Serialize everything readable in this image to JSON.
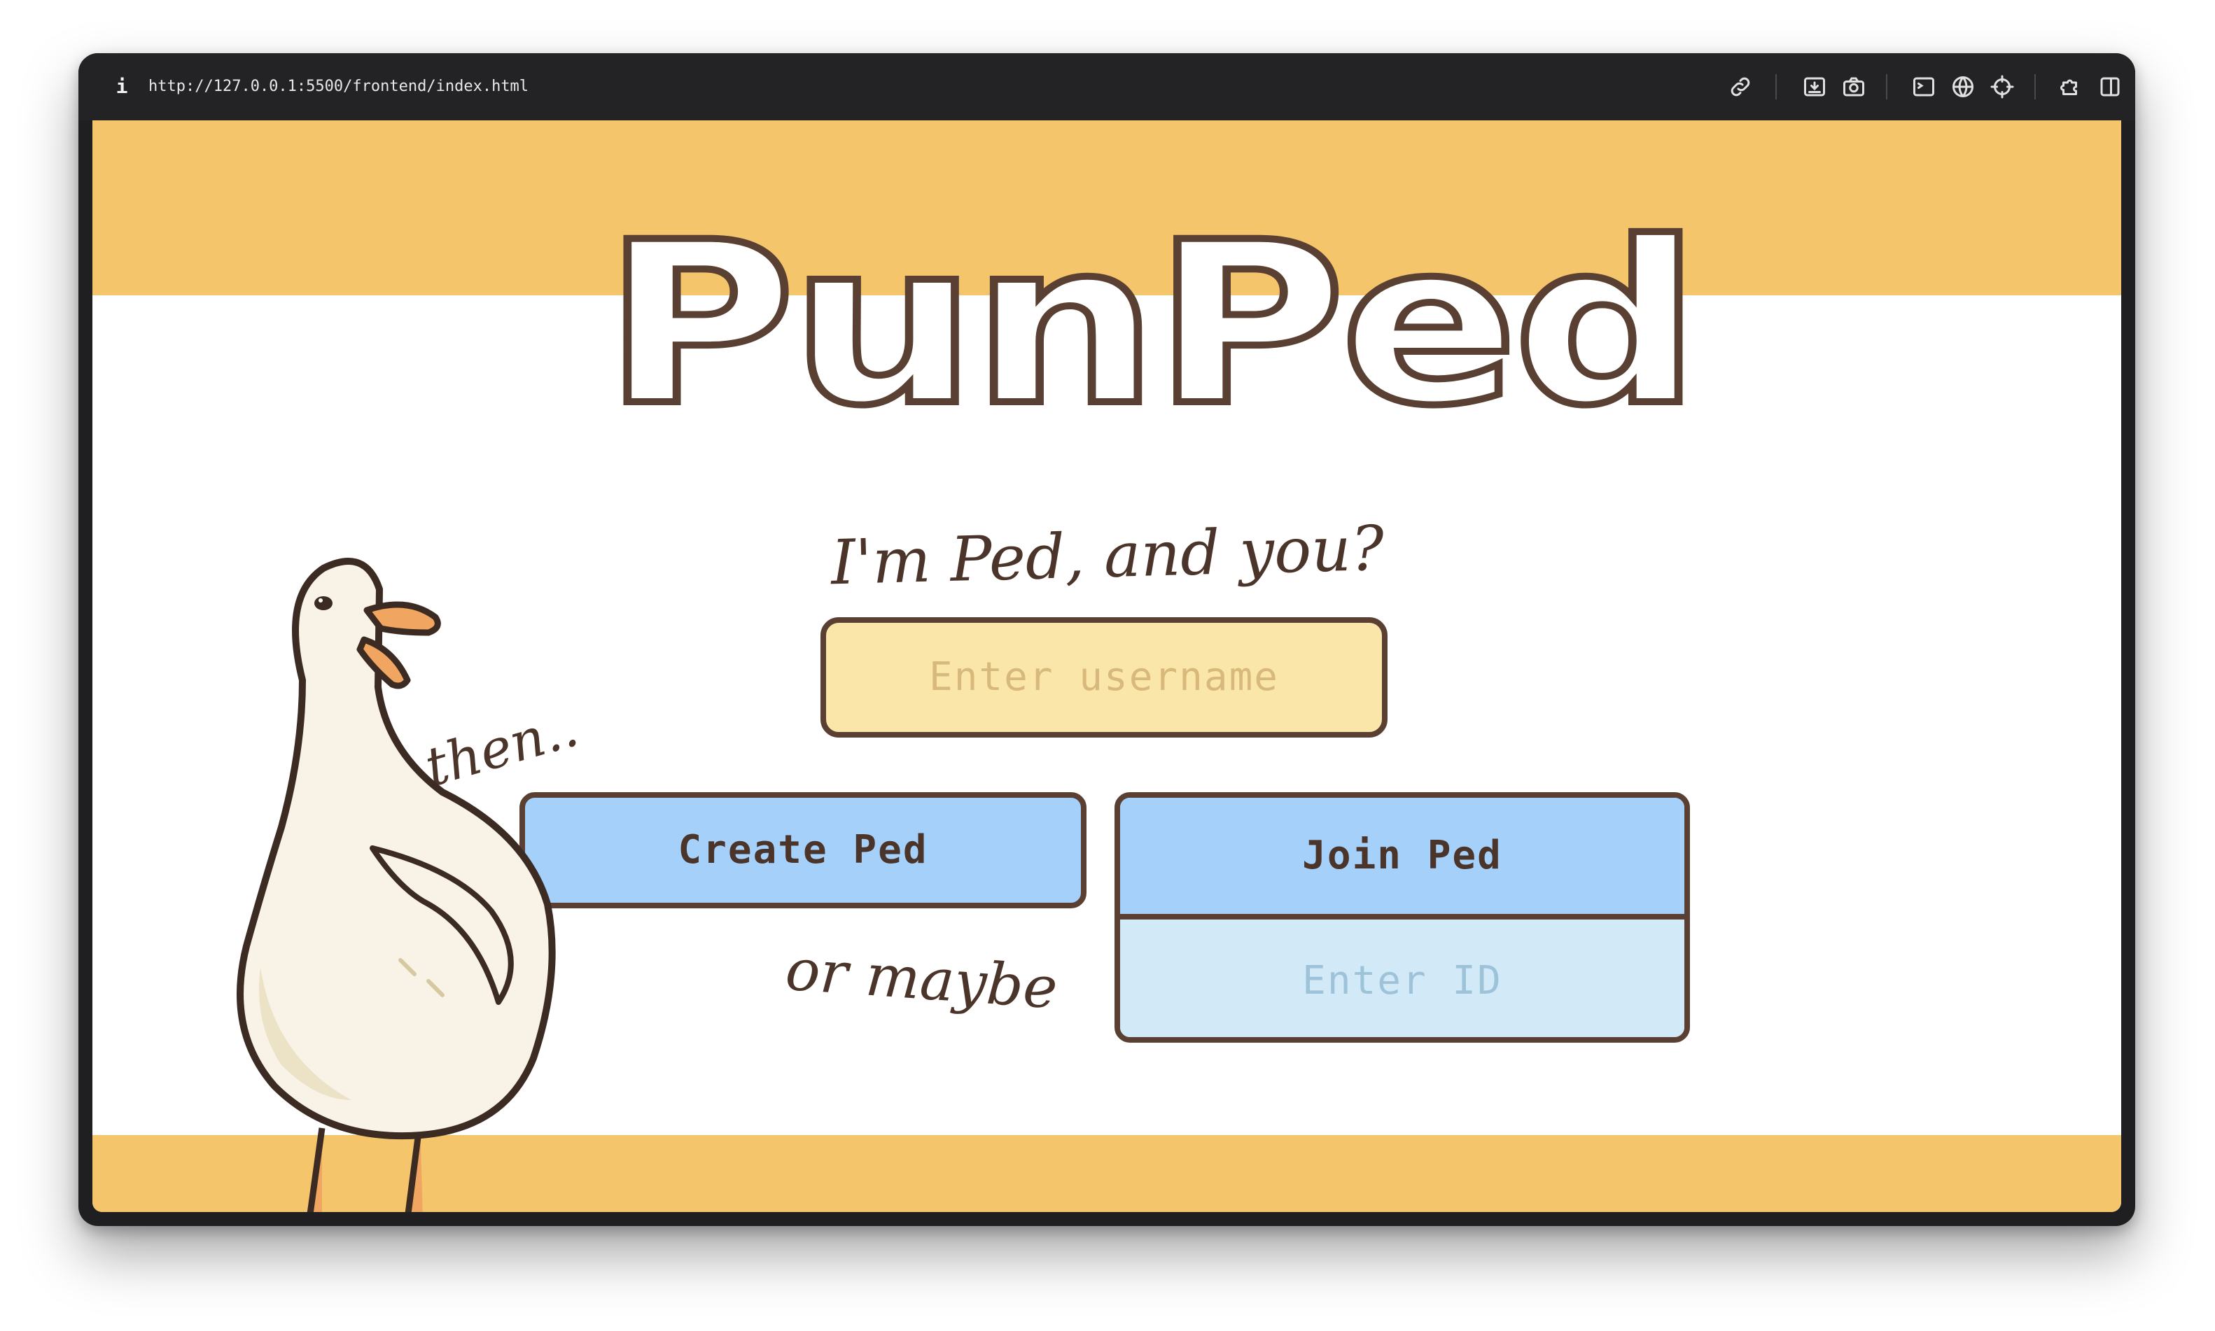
{
  "browser": {
    "url": "http://127.0.0.1:5500/frontend/index.html",
    "info_icon": "i",
    "toolbar_icons": [
      "link-icon",
      "download-icon",
      "camera-icon",
      "terminal-icon",
      "globe-icon",
      "crosshair-icon",
      "extensions-icon",
      "sidebar-icon"
    ]
  },
  "page": {
    "logo": "PunPed",
    "tagline": "I'm Ped, and you?",
    "username_placeholder": "Enter username",
    "then_label": "then..",
    "create_button": "Create Ped",
    "or_maybe_label": "or maybe",
    "join_button": "Join Ped",
    "id_placeholder": "Enter ID"
  },
  "colors": {
    "band": "#f4c56a",
    "outline": "#5a4033",
    "button_blue": "#a4d0fa",
    "input_yellow": "#fbe6a9",
    "input_blue": "#d2eaf8"
  }
}
